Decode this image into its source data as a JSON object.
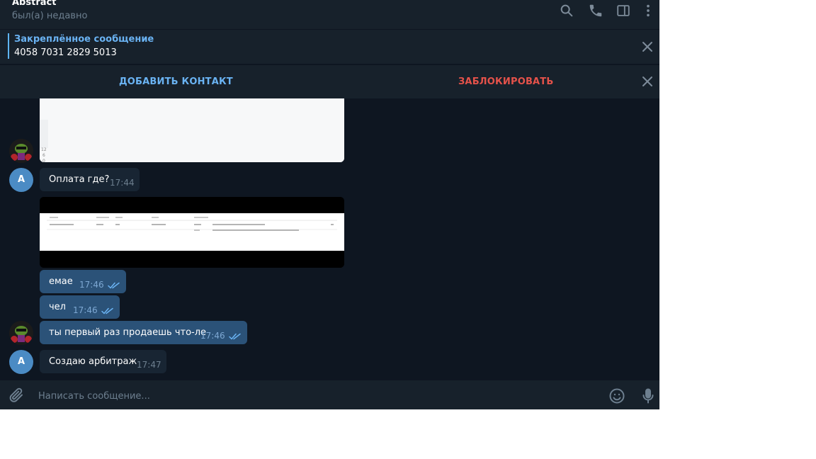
{
  "header": {
    "title": "Abstract",
    "status": "был(а) недавно",
    "icons": [
      "search-icon",
      "phone-icon",
      "sidebar-toggle-icon",
      "more-vertical-icon"
    ]
  },
  "pinned": {
    "title": "Закреплённое сообщение",
    "text": "4058 7031 2829 5013"
  },
  "action_bar": {
    "add_contact": "ДОБАВИТЬ КОНТАКТ",
    "block": "ЗАБЛОКИРОВАТЬ"
  },
  "avatars": {
    "letter": "A"
  },
  "messages": [
    {
      "text": "Оплата где?",
      "time": "17:44",
      "direction": "in"
    },
    {
      "text": "емае",
      "time": "17:46",
      "direction": "out",
      "read": true
    },
    {
      "text": "чел",
      "time": "17:46",
      "direction": "out",
      "read": true
    },
    {
      "text": "ты первый раз продаешь что-ле",
      "time": "17:46",
      "direction": "out",
      "read": true
    },
    {
      "text": "Создаю арбитраж",
      "time": "17:47",
      "direction": "in"
    }
  ],
  "composer": {
    "placeholder": "Написать сообщение...",
    "icons": [
      "attach-icon",
      "emoji-icon",
      "microphone-icon"
    ]
  },
  "colors": {
    "chat_bg": "#0e1621",
    "panel_bg": "#17212b",
    "incoming_bubble": "#182533",
    "outgoing_bubble": "#2b5278",
    "accent": "#6ab3f3",
    "danger": "#e5524a"
  }
}
